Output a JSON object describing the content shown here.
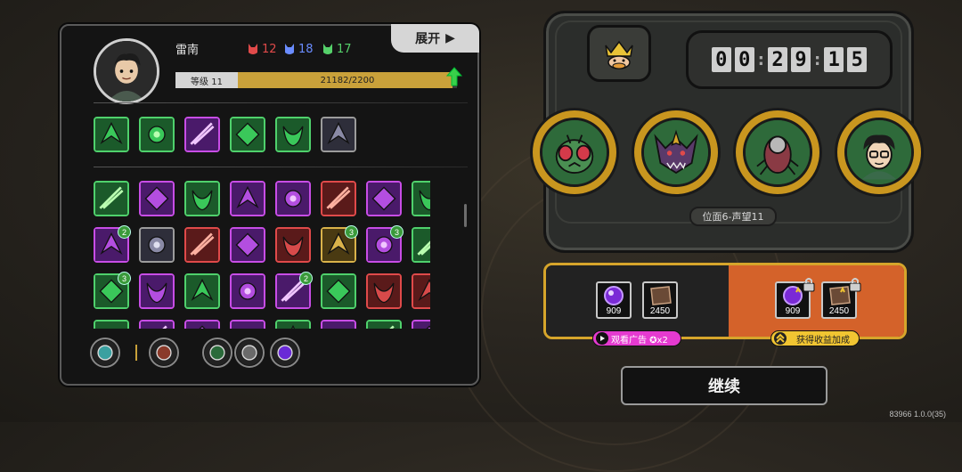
{
  "player": {
    "name": "雷南",
    "stats": [
      {
        "icon": "red-demon-icon",
        "value": "12",
        "color": "#e04a4a"
      },
      {
        "icon": "blue-demon-icon",
        "value": "18",
        "color": "#6a8cff"
      },
      {
        "icon": "green-demon-icon",
        "value": "17",
        "color": "#55d06a"
      }
    ],
    "level_label": "等级 11",
    "exp_text": "21182/2200",
    "exp_progress": 0.98
  },
  "expand_label": "展开",
  "equipped_skills": [
    {
      "icon": "green-spear-skill-icon",
      "border": "green"
    },
    {
      "icon": "lightning-blade-skill-icon",
      "border": "green"
    },
    {
      "icon": "purple-orb-skill-icon",
      "border": "purple"
    },
    {
      "icon": "green-axe-skill-icon",
      "border": "green"
    },
    {
      "icon": "leaf-burst-skill-icon",
      "border": "green"
    },
    {
      "icon": "armor-plate-skill-icon",
      "border": "gray"
    }
  ],
  "skill_grid": [
    {
      "icon": "purple-arrow-skill-icon",
      "border": "green"
    },
    {
      "icon": "bandage-skill-icon",
      "border": "purple"
    },
    {
      "icon": "green-swirl-skill-icon",
      "border": "green"
    },
    {
      "icon": "purple-blade-skill-icon",
      "border": "purple"
    },
    {
      "icon": "purple-beast-skill-icon",
      "border": "purple"
    },
    {
      "icon": "green-shield-skill-icon",
      "border": "red"
    },
    {
      "icon": "green-fang-skill-icon",
      "border": "purple"
    },
    {
      "icon": "purple-eye-skill-icon",
      "border": "green"
    },
    {
      "icon": "gold-vortex-skill-icon",
      "border": "purple",
      "count": "2"
    },
    {
      "icon": "red-claw-skill-icon",
      "border": "gray"
    },
    {
      "icon": "blue-cloak-skill-icon",
      "border": "red"
    },
    {
      "icon": "purple-crystal-skill-icon",
      "border": "purple"
    },
    {
      "icon": "red-slash-skill-icon",
      "border": "red"
    },
    {
      "icon": "spiked-fence-skill-icon",
      "border": "gold",
      "count": "3"
    },
    {
      "icon": "purple-star-skill-icon",
      "border": "purple",
      "count": "3"
    },
    {
      "icon": "purple-skull-skill-icon",
      "border": "green"
    },
    {
      "icon": "green-burst-skill-icon",
      "border": "green",
      "count": "3"
    },
    {
      "icon": "red-rift-skill-icon",
      "border": "purple"
    },
    {
      "icon": "purple-book-skill-icon",
      "border": "green"
    },
    {
      "icon": "crossed-blades-skill-icon",
      "border": "purple"
    },
    {
      "icon": "purple-pillar-skill-icon",
      "border": "purple",
      "count": "2"
    },
    {
      "icon": "green-wind-skill-icon",
      "border": "green"
    },
    {
      "icon": "gold-arch-skill-icon",
      "border": "red"
    },
    {
      "icon": "blue-warrior-skill-icon",
      "border": "red"
    },
    {
      "icon": "green-leaf-skill-icon",
      "border": "green"
    },
    {
      "icon": "purple-flame-skill-icon",
      "border": "purple"
    },
    {
      "icon": "red-spike-skill-icon",
      "border": "purple"
    },
    {
      "icon": "purple-mask-skill-icon",
      "border": "purple"
    },
    {
      "icon": "green-hex-skill-icon",
      "border": "green"
    },
    {
      "icon": "purple-gem-skill-icon",
      "border": "purple"
    },
    {
      "icon": "green-claw-skill-icon",
      "border": "green"
    },
    {
      "icon": "purple-rune-skill-icon",
      "border": "purple"
    }
  ],
  "equipment": [
    {
      "icon": "potion-character-icon"
    },
    {
      "icon": "sword-item-icon"
    },
    {
      "icon": "green-flask-icon"
    },
    {
      "icon": "gray-stone-icon"
    },
    {
      "icon": "purple-charm-icon"
    }
  ],
  "timer": {
    "h": "00",
    "m": "29",
    "s": "15"
  },
  "crown_icon": "crowned-duck-icon",
  "enemies": [
    {
      "icon": "fly-monster-icon"
    },
    {
      "icon": "horned-beast-icon"
    },
    {
      "icon": "insect-shell-icon"
    },
    {
      "icon": "glasses-boy-icon"
    }
  ],
  "position_label": "位面6-声望11",
  "rewards": {
    "base": [
      {
        "icon": "purple-orb-icon",
        "value": "909"
      },
      {
        "icon": "brown-book-icon",
        "value": "2450"
      }
    ],
    "bonus": [
      {
        "icon": "purple-orb-icon",
        "value": "909"
      },
      {
        "icon": "brown-book-icon",
        "value": "2450"
      }
    ],
    "watch_ad_label": "观看广告 ✪x2",
    "bonus_label": "获得收益加成"
  },
  "continue_label": "继续",
  "version": "83966 1.0.0(35)",
  "colors": {
    "accent_gold": "#d6a52b",
    "orange_panel": "#d4622a",
    "ad_pink": "#e53ad0"
  }
}
